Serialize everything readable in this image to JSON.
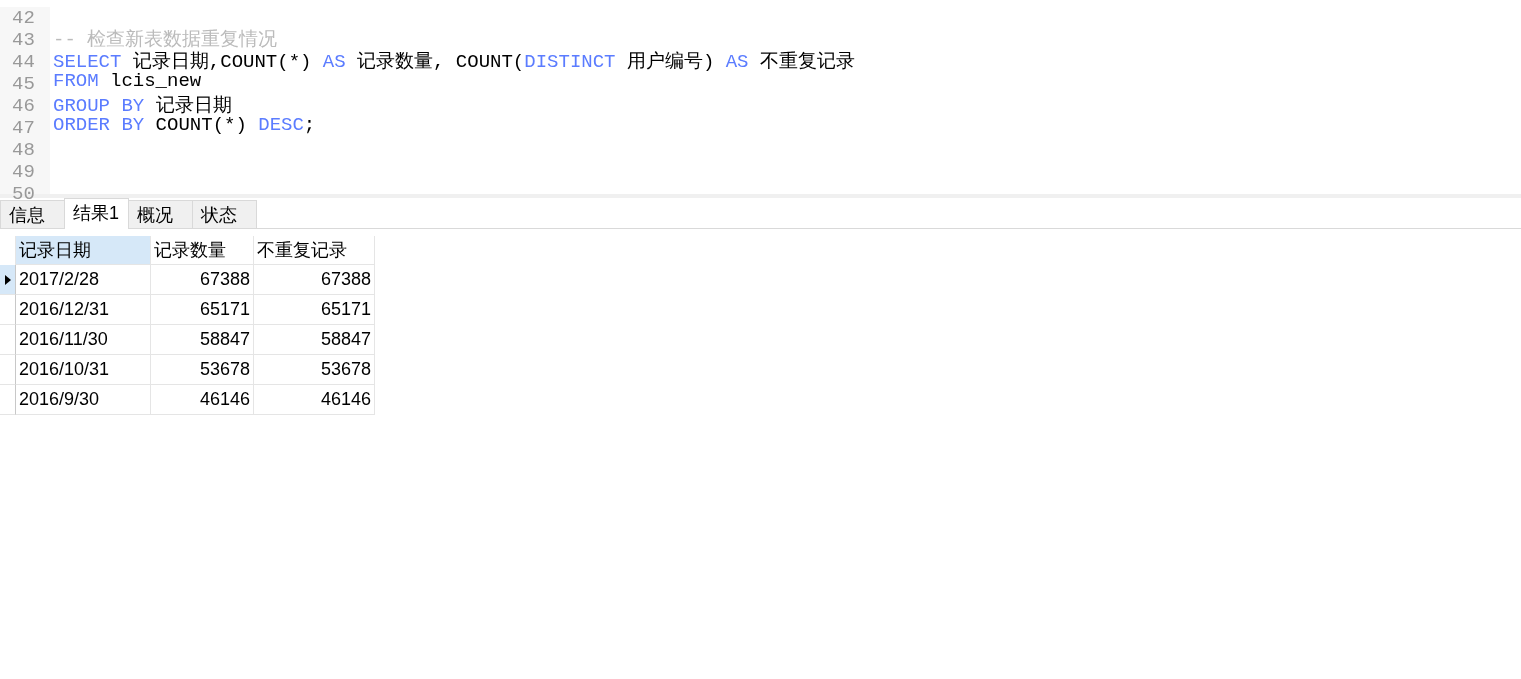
{
  "editor": {
    "lines": [
      {
        "number": "42"
      },
      {
        "number": "43",
        "tokens": [
          {
            "kind": "comment",
            "text": "-- 检查新表数据重复情况"
          }
        ]
      },
      {
        "number": "44",
        "tokens": [
          {
            "kind": "keyword",
            "text": "SELECT"
          },
          {
            "kind": "plain",
            "text": " 记录日期,COUNT(*) "
          },
          {
            "kind": "keyword",
            "text": "AS"
          },
          {
            "kind": "plain",
            "text": " 记录数量, COUNT("
          },
          {
            "kind": "keyword",
            "text": "DISTINCT"
          },
          {
            "kind": "plain",
            "text": " 用户编号) "
          },
          {
            "kind": "keyword",
            "text": "AS"
          },
          {
            "kind": "plain",
            "text": " 不重复记录"
          }
        ]
      },
      {
        "number": "45",
        "tokens": [
          {
            "kind": "keyword",
            "text": "FROM"
          },
          {
            "kind": "plain",
            "text": " lcis_new"
          }
        ]
      },
      {
        "number": "46",
        "tokens": [
          {
            "kind": "keyword",
            "text": "GROUP BY"
          },
          {
            "kind": "plain",
            "text": " 记录日期"
          }
        ]
      },
      {
        "number": "47",
        "tokens": [
          {
            "kind": "keyword",
            "text": "ORDER BY"
          },
          {
            "kind": "plain",
            "text": " COUNT(*) "
          },
          {
            "kind": "keyword",
            "text": "DESC"
          },
          {
            "kind": "plain",
            "text": ";"
          }
        ]
      },
      {
        "number": "48"
      },
      {
        "number": "49"
      },
      {
        "number": "50"
      }
    ]
  },
  "tabs": [
    {
      "label": "信息",
      "selected": false
    },
    {
      "label": "结果1",
      "selected": true
    },
    {
      "label": "概况",
      "selected": false
    },
    {
      "label": "状态",
      "selected": false
    }
  ],
  "table": {
    "columns": [
      {
        "label": "记录日期",
        "selected": true,
        "kind": "date"
      },
      {
        "label": "记录数量",
        "selected": false,
        "kind": "number"
      },
      {
        "label": "不重复记录",
        "selected": false,
        "kind": "number"
      }
    ],
    "rows": [
      {
        "selected": true,
        "cells": [
          "2017/2/28",
          "67388",
          "67388"
        ]
      },
      {
        "selected": false,
        "cells": [
          "2016/12/31",
          "65171",
          "65171"
        ]
      },
      {
        "selected": false,
        "cells": [
          "2016/11/30",
          "58847",
          "58847"
        ]
      },
      {
        "selected": false,
        "cells": [
          "2016/10/31",
          "53678",
          "53678"
        ]
      },
      {
        "selected": false,
        "cells": [
          "2016/9/30",
          "46146",
          "46146"
        ]
      }
    ]
  }
}
